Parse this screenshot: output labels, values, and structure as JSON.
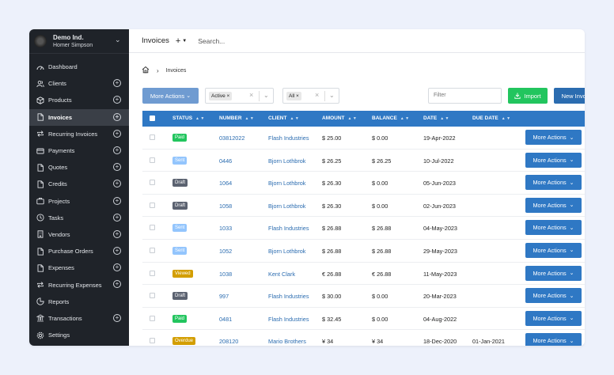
{
  "company": {
    "name": "Demo Ind.",
    "user": "Homer Simpson"
  },
  "sidebar": {
    "items": [
      {
        "label": "Dashboard",
        "icon": "dashboard-icon",
        "plus": false,
        "active": false
      },
      {
        "label": "Clients",
        "icon": "users-icon",
        "plus": true,
        "active": false
      },
      {
        "label": "Products",
        "icon": "box-icon",
        "plus": true,
        "active": false
      },
      {
        "label": "Invoices",
        "icon": "file-icon",
        "plus": true,
        "active": true
      },
      {
        "label": "Recurring Invoices",
        "icon": "repeat-icon",
        "plus": true,
        "active": false
      },
      {
        "label": "Payments",
        "icon": "credit-card-icon",
        "plus": true,
        "active": false
      },
      {
        "label": "Quotes",
        "icon": "file-icon",
        "plus": true,
        "active": false
      },
      {
        "label": "Credits",
        "icon": "file-icon",
        "plus": true,
        "active": false
      },
      {
        "label": "Projects",
        "icon": "briefcase-icon",
        "plus": true,
        "active": false
      },
      {
        "label": "Tasks",
        "icon": "clock-icon",
        "plus": true,
        "active": false
      },
      {
        "label": "Vendors",
        "icon": "building-icon",
        "plus": true,
        "active": false
      },
      {
        "label": "Purchase Orders",
        "icon": "file-icon",
        "plus": true,
        "active": false
      },
      {
        "label": "Expenses",
        "icon": "file-icon",
        "plus": true,
        "active": false
      },
      {
        "label": "Recurring Expenses",
        "icon": "repeat-icon",
        "plus": true,
        "active": false
      },
      {
        "label": "Reports",
        "icon": "chart-icon",
        "plus": false,
        "active": false
      },
      {
        "label": "Transactions",
        "icon": "bank-icon",
        "plus": true,
        "active": false
      },
      {
        "label": "Settings",
        "icon": "gear-icon",
        "plus": false,
        "active": false
      }
    ]
  },
  "topbar": {
    "title": "Invoices",
    "add": "+",
    "search_placeholder": "Search..."
  },
  "breadcrumb": {
    "current": "Invoices"
  },
  "toolbar": {
    "more_actions": "More Actions",
    "status_chip": "Active",
    "client_chip": "All",
    "filter_placeholder": "Filter",
    "import": "Import",
    "new_invoice": "New Invoice"
  },
  "table": {
    "headers": [
      "STATUS",
      "NUMBER",
      "CLIENT",
      "AMOUNT",
      "BALANCE",
      "DATE",
      "DUE DATE"
    ],
    "row_action": "More Actions",
    "status_colors": {
      "Paid": "#22c55e",
      "Sent": "#93c5fd",
      "Draft": "#5b6270",
      "Viewed": "#d39e00",
      "Overdue": "#d39e00"
    },
    "rows": [
      {
        "status": "Paid",
        "number": "03812022",
        "client": "Flash Industries",
        "amount": "$ 25.00",
        "balance": "$ 0.00",
        "date": "19-Apr-2022",
        "due": ""
      },
      {
        "status": "Sent",
        "number": "0446",
        "client": "Bjorn Lothbrok",
        "amount": "$ 26.25",
        "balance": "$ 26.25",
        "date": "10-Jul-2022",
        "due": ""
      },
      {
        "status": "Draft",
        "number": "1064",
        "client": "Bjorn Lothbrok",
        "amount": "$ 26.30",
        "balance": "$ 0.00",
        "date": "05-Jun-2023",
        "due": ""
      },
      {
        "status": "Draft",
        "number": "1058",
        "client": "Bjorn Lothbrok",
        "amount": "$ 26.30",
        "balance": "$ 0.00",
        "date": "02-Jun-2023",
        "due": ""
      },
      {
        "status": "Sent",
        "number": "1033",
        "client": "Flash Industries",
        "amount": "$ 26.88",
        "balance": "$ 26.88",
        "date": "04-May-2023",
        "due": ""
      },
      {
        "status": "Sent",
        "number": "1052",
        "client": "Bjorn Lothbrok",
        "amount": "$ 26.88",
        "balance": "$ 26.88",
        "date": "29-May-2023",
        "due": ""
      },
      {
        "status": "Viewed",
        "number": "1038",
        "client": "Kent Clark",
        "amount": "€ 26.88",
        "balance": "€ 26.88",
        "date": "11-May-2023",
        "due": ""
      },
      {
        "status": "Draft",
        "number": "997",
        "client": "Flash Industries",
        "amount": "$ 30.00",
        "balance": "$ 0.00",
        "date": "20-Mar-2023",
        "due": ""
      },
      {
        "status": "Paid",
        "number": "0481",
        "client": "Flash Industries",
        "amount": "$ 32.45",
        "balance": "$ 0.00",
        "date": "04-Aug-2022",
        "due": ""
      },
      {
        "status": "Overdue",
        "number": "208120",
        "client": "Mario Brothers",
        "amount": "¥ 34",
        "balance": "¥ 34",
        "date": "18-Dec-2020",
        "due": "01-Jan-2021"
      }
    ]
  }
}
